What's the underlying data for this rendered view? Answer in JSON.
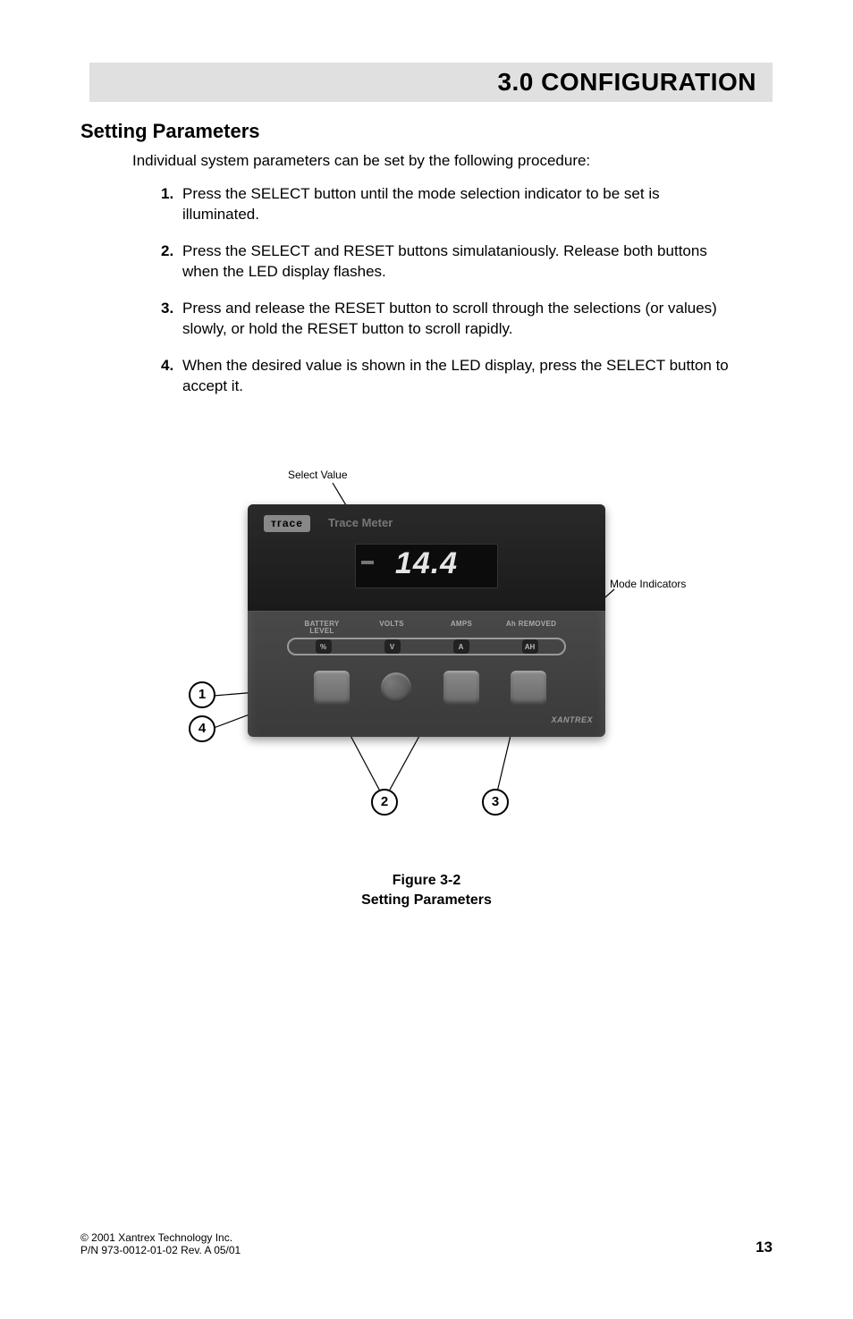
{
  "header": {
    "title": "3.0  CONFIGURATION"
  },
  "section": {
    "heading": "Setting Parameters",
    "intro": "Individual system parameters can be set by the following procedure:",
    "steps": [
      {
        "num": "1.",
        "text": "Press the SELECT button until the mode selection indicator to be set is illuminated."
      },
      {
        "num": "2.",
        "text": "Press the SELECT and RESET buttons simulataniously. Release both buttons when the LED display flashes."
      },
      {
        "num": "3.",
        "text": "Press and release the RESET button to scroll through the selections (or values) slowly, or hold the RESET button to scroll rapidly."
      },
      {
        "num": "4.",
        "text": "When the desired value is shown in the LED display, press the SELECT button to accept it."
      }
    ]
  },
  "figure": {
    "device": {
      "brand": "тгасе",
      "title": "Trace Meter",
      "lcd_value": "14.4",
      "indicators": {
        "labels": {
          "battery": "BATTERY\nLEVEL",
          "volts": "VOLTS",
          "amps": "AMPS",
          "ah": "Ah REMOVED"
        },
        "icons": {
          "pct": "%",
          "v": "V",
          "a": "A",
          "ah": "AH"
        }
      },
      "logo": "XANTREX"
    },
    "callouts": {
      "select_value": "Select Value",
      "mode_indicators": "Mode Indicators",
      "c1": "1",
      "c2": "2",
      "c3": "3",
      "c4": "4"
    },
    "caption_line1": "Figure 3-2",
    "caption_line2": "Setting Parameters"
  },
  "footer": {
    "copyright": "© 2001 Xantrex Technology Inc.",
    "pn": "P/N 973-0012-01-02 Rev. A 05/01",
    "page": "13"
  }
}
